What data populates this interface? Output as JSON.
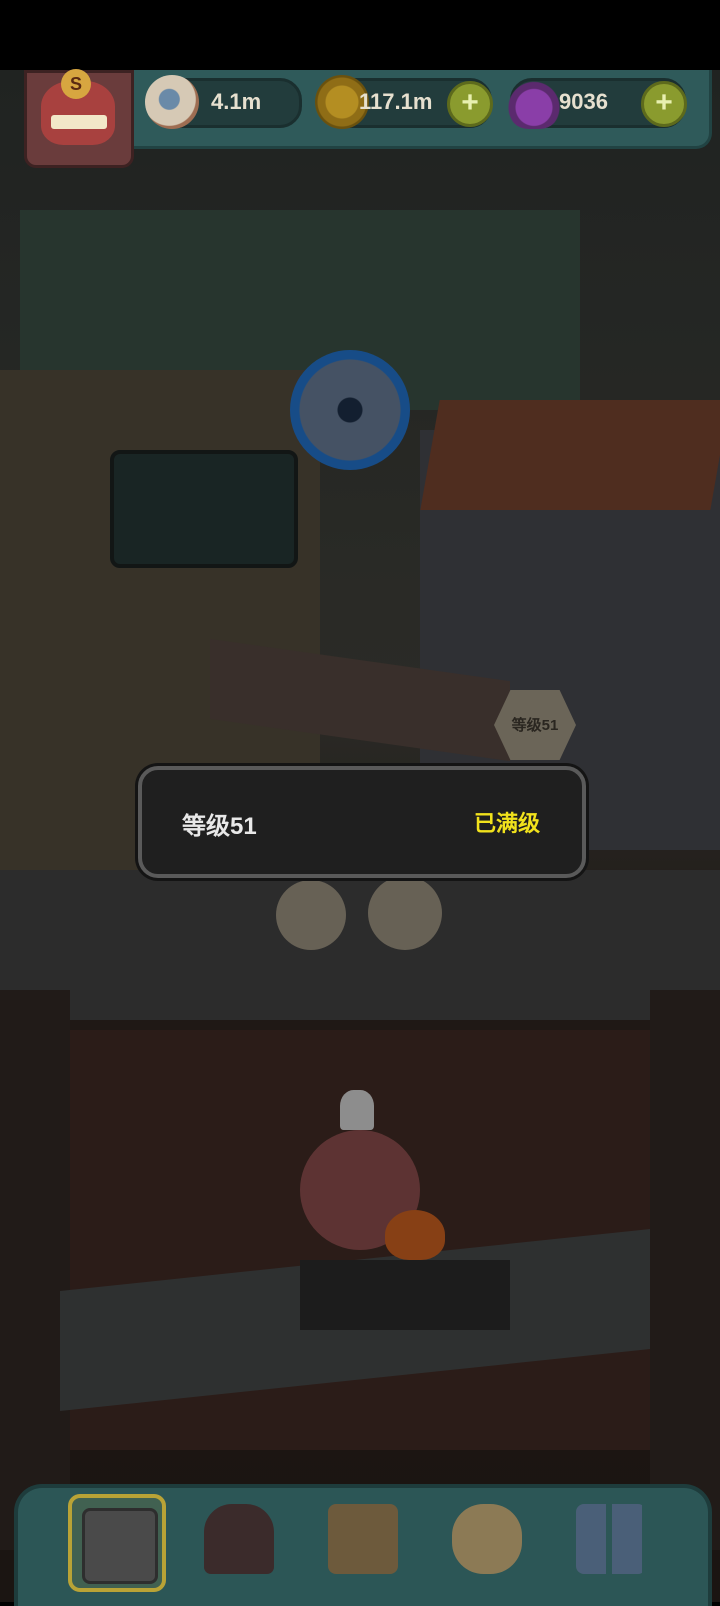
{
  "hud": {
    "eyeballs": "4.1m",
    "coins": "117.1m",
    "potions": "9036",
    "badge_letter": "S"
  },
  "scene": {
    "shop_level_tag": "等级51"
  },
  "dialog": {
    "level_text": "等级51",
    "status_text": "已满级"
  },
  "nav": {
    "items": [
      "shop-icon",
      "furnace-icon",
      "recipe-book-icon",
      "money-bag-icon",
      "grid-icon"
    ]
  },
  "colors": {
    "accent_yellow": "#f1e21c",
    "hud_teal": "#2f5a5a",
    "plus_green": "#8a9b2e"
  }
}
